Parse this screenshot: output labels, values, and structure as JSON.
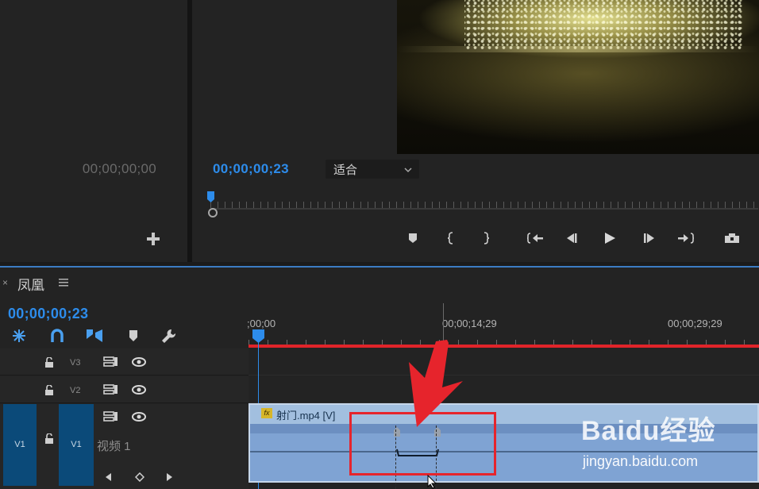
{
  "source_monitor": {
    "timecode": "00;00;00;00",
    "add_icon": "plus-icon"
  },
  "program_monitor": {
    "timecode": "00;00;00;23",
    "fit_selector": {
      "value": "适合",
      "icon": "chevron-down-icon"
    },
    "transport": [
      {
        "name": "add-marker-button",
        "icon": "marker-icon"
      },
      {
        "name": "mark-in-button",
        "icon": "brace-left-icon"
      },
      {
        "name": "mark-out-button",
        "icon": "brace-right-icon"
      },
      {
        "name": "go-to-in-button",
        "icon": "go-to-in-icon"
      },
      {
        "name": "step-back-button",
        "icon": "step-back-icon"
      },
      {
        "name": "play-button",
        "icon": "play-icon"
      },
      {
        "name": "step-forward-button",
        "icon": "step-forward-icon"
      },
      {
        "name": "go-to-out-button",
        "icon": "go-to-out-icon"
      },
      {
        "name": "export-frame-button",
        "icon": "camera-icon"
      }
    ]
  },
  "timeline": {
    "close_symbol": "×",
    "sequence_name": "凤凰",
    "menu_icon": "hamburger-menu-icon",
    "timecode": "00;00;00;23",
    "tools": [
      "snap-icon",
      "linked-selection-icon",
      "add-edit-icon",
      "marker-icon",
      "wrench-icon"
    ],
    "ruler_labels": [
      ";00;00",
      "00;00;14;29",
      "00;00;29;29"
    ],
    "tracks": [
      {
        "id": "V3",
        "lock": "lock-open-icon"
      },
      {
        "id": "V2",
        "lock": "lock-open-icon"
      },
      {
        "id": "V1",
        "source_patch": "V1",
        "name": "视频 1",
        "lock": "lock-open-icon"
      }
    ],
    "clip": {
      "name": "射门.mp4 [V]",
      "fx_badge": "fx"
    },
    "keyframe_nav": [
      "kf-prev-icon",
      "kf-add-icon",
      "kf-next-icon"
    ]
  },
  "watermark": {
    "logo": "Baidu经验",
    "url": "jingyan.baidu.com"
  },
  "colors": {
    "accent": "#2d8ceb",
    "clip": "#7fa3d3",
    "work_area": "#e0242a",
    "annotation": "#e6242c"
  }
}
